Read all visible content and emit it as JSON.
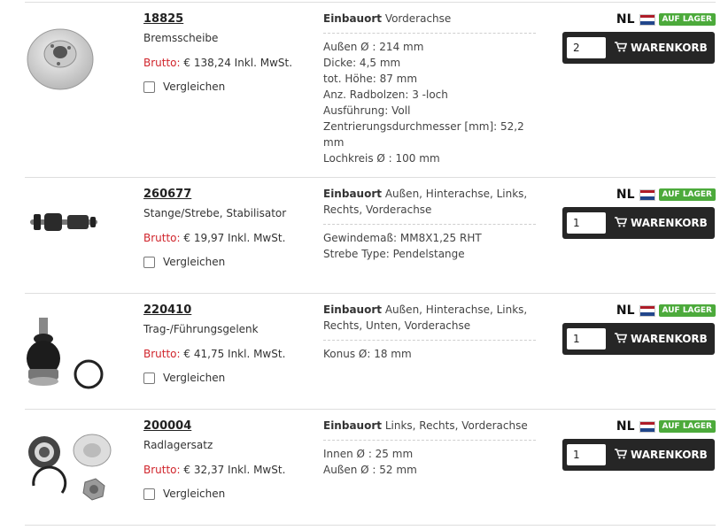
{
  "items": [
    {
      "art_nr": "18825",
      "name": "Bremsscheibe",
      "price_label": "Brutto:",
      "price_value": "€ 138,24 Inkl. MwSt.",
      "compare_label": "Vergleichen",
      "einbauort_label": "Einbauort",
      "einbauort_value": "Vorderachse",
      "specs": [
        "Außen Ø : 214 mm",
        "Dicke: 4,5 mm",
        "tot. Höhe: 87 mm",
        "Anz. Radbolzen: 3 -loch",
        "Ausführung: Voll",
        "Zentrierungsdurchmesser [mm]: 52,2 mm",
        "Lochkreis Ø : 100 mm"
      ],
      "country": "NL",
      "stock_badge": "AUF LAGER",
      "qty": "2",
      "cart_label": "WARENKORB",
      "image_icon": "brake-disc-icon"
    },
    {
      "art_nr": "260677",
      "name": "Stange/Strebe, Stabilisator",
      "price_label": "Brutto:",
      "price_value": "€ 19,97 Inkl. MwSt.",
      "compare_label": "Vergleichen",
      "einbauort_label": "Einbauort",
      "einbauort_value": "Außen, Hinterachse, Links, Rechts, Vorderachse",
      "specs": [
        "Gewindemaß: MM8X1,25 RHT",
        "Strebe Type: Pendelstange"
      ],
      "country": "NL",
      "stock_badge": "AUF LAGER",
      "qty": "1",
      "cart_label": "WARENKORB",
      "image_icon": "stabilizer-link-icon"
    },
    {
      "art_nr": "220410",
      "name": "Trag-/Führungsgelenk",
      "price_label": "Brutto:",
      "price_value": "€ 41,75 Inkl. MwSt.",
      "compare_label": "Vergleichen",
      "einbauort_label": "Einbauort",
      "einbauort_value": "Außen, Hinterachse, Links, Rechts, Unten, Vorderachse",
      "specs": [
        "Konus Ø: 18 mm"
      ],
      "country": "NL",
      "stock_badge": "AUF LAGER",
      "qty": "1",
      "cart_label": "WARENKORB",
      "image_icon": "ball-joint-icon"
    },
    {
      "art_nr": "200004",
      "name": "Radlagersatz",
      "price_label": "Brutto:",
      "price_value": "€ 32,37 Inkl. MwSt.",
      "compare_label": "Vergleichen",
      "einbauort_label": "Einbauort",
      "einbauort_value": "Links, Rechts, Vorderachse",
      "specs": [
        "Innen Ø : 25 mm",
        "Außen Ø : 52 mm"
      ],
      "country": "NL",
      "stock_badge": "AUF LAGER",
      "qty": "1",
      "cart_label": "WARENKORB",
      "image_icon": "wheel-bearing-kit-icon"
    }
  ],
  "colors": {
    "price_label": "#d0242b",
    "stock_badge": "#4caa3b",
    "cart_button": "#262626",
    "flag_red": "#ae1c28",
    "flag_white": "#ffffff",
    "flag_blue": "#21468b"
  }
}
